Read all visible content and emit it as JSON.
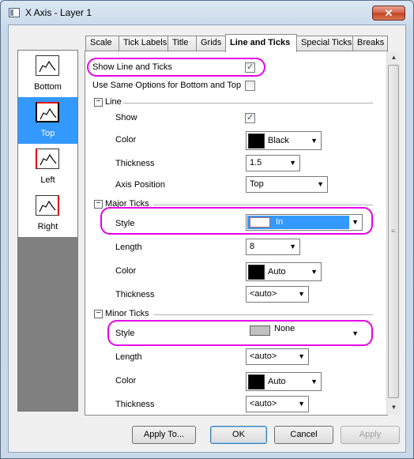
{
  "window": {
    "title": "X Axis - Layer 1",
    "close_label": "✕"
  },
  "left_panel": {
    "items": [
      {
        "label": "Bottom",
        "selected": false
      },
      {
        "label": "Top",
        "selected": true
      },
      {
        "label": "Left",
        "selected": false
      },
      {
        "label": "Right",
        "selected": false
      }
    ]
  },
  "tabs": [
    "Scale",
    "Tick Labels",
    "Title",
    "Grids",
    "Line and Ticks",
    "Special Ticks",
    "Breaks"
  ],
  "active_tab": "Line and Ticks",
  "options": {
    "show_line_ticks": {
      "label": "Show Line and Ticks",
      "checked": true
    },
    "same_options": {
      "label": "Use Same Options for Bottom and Top",
      "checked": false
    }
  },
  "line_section": {
    "title": "Line",
    "toggle": "−",
    "show_label": "Show",
    "show_checked": true,
    "color_label": "Color",
    "color_value": "Black",
    "color_swatch": "#000000",
    "thickness_label": "Thickness",
    "thickness_value": "1.5",
    "axis_position_label": "Axis Position",
    "axis_position_value": "Top"
  },
  "major_section": {
    "title": "Major Ticks",
    "toggle": "−",
    "style_label": "Style",
    "style_value": "In",
    "length_label": "Length",
    "length_value": "8",
    "color_label": "Color",
    "color_value": "Auto",
    "color_swatch": "#000000",
    "thickness_label": "Thickness",
    "thickness_value": "<auto>"
  },
  "minor_section": {
    "title": "Minor Ticks",
    "toggle": "−",
    "style_label": "Style",
    "style_value": "None",
    "style_swatch": "#c0c0c0",
    "length_label": "Length",
    "length_value": "<auto>",
    "color_label": "Color",
    "color_value": "Auto",
    "color_swatch": "#000000",
    "thickness_label": "Thickness",
    "thickness_value": "<auto>"
  },
  "buttons": {
    "apply_to": "Apply To...",
    "ok": "OK",
    "cancel": "Cancel",
    "apply": "Apply"
  },
  "colors": {
    "selection": "#3399ff",
    "highlight": "#e600e6"
  }
}
